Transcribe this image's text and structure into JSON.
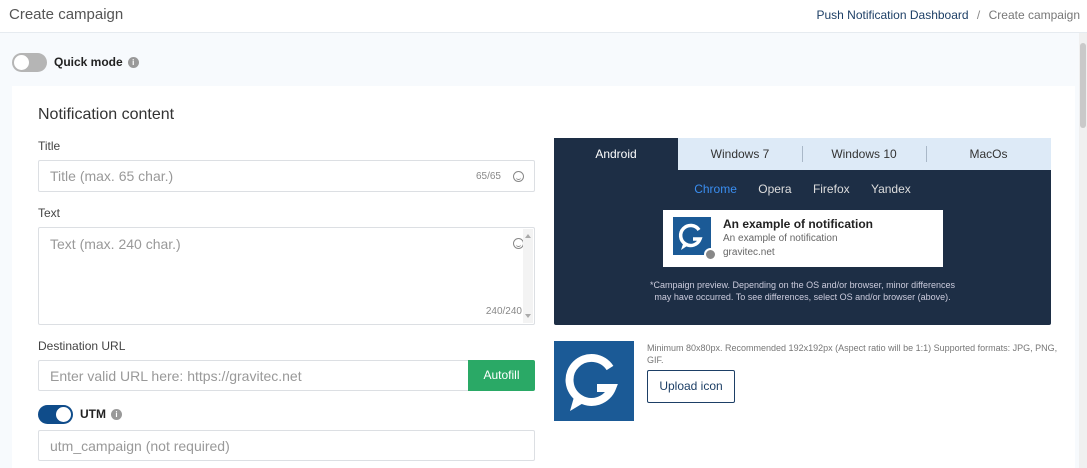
{
  "header": {
    "title": "Create campaign",
    "breadcrumb": {
      "link": "Push Notification Dashboard",
      "separator": "/",
      "current": "Create campaign"
    }
  },
  "quick_mode": {
    "label": "Quick mode",
    "enabled": false,
    "info_icon": "i"
  },
  "content": {
    "section_title": "Notification content",
    "title_field": {
      "label": "Title",
      "placeholder": "Title (max. 65 char.)",
      "counter": "65/65"
    },
    "text_field": {
      "label": "Text",
      "placeholder": "Text (max. 240 char.)",
      "counter": "240/240"
    },
    "url_field": {
      "label": "Destination URL",
      "placeholder": "Enter valid URL here: https://gravitec.net",
      "button": "Autofill"
    },
    "utm": {
      "label": "UTM",
      "enabled": true,
      "info_icon": "i",
      "placeholder": "utm_campaign (not required)"
    }
  },
  "preview": {
    "tabs": [
      "Android",
      "Windows 7",
      "Windows 10",
      "MacOs"
    ],
    "active_tab": "Android",
    "browsers": [
      "Chrome",
      "Opera",
      "Firefox",
      "Yandex"
    ],
    "active_browser": "Chrome",
    "notification": {
      "title": "An example of notification",
      "text": "An example of notification",
      "domain": "gravitec.net"
    },
    "note": "*Campaign preview. Depending on the OS and/or browser, minor differences may have occurred. To see differences, select OS and/or browser (above)."
  },
  "icon_upload": {
    "help": "Minimum 80x80px. Recommended 192x192px (Aspect ratio will be 1:1) Supported formats: JPG, PNG, GIF.",
    "button": "Upload icon"
  },
  "colors": {
    "brand": "#1b5a96",
    "autofill": "#2aa966",
    "preview_bg": "#1d2e45",
    "link": "#3a8ef0"
  }
}
